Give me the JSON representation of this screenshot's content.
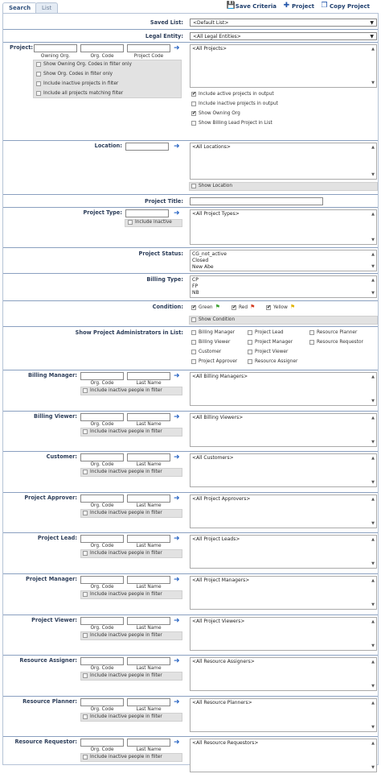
{
  "tabs": [
    {
      "label": "Search"
    },
    {
      "label": "List"
    }
  ],
  "actions": {
    "save": "Save Criteria",
    "project": "Project",
    "copy": "Copy Project"
  },
  "saved_list": {
    "label": "Saved List:",
    "value": "<Default List>"
  },
  "legal_entity": {
    "label": "Legal Entity:",
    "value": "<All Legal Entities>"
  },
  "project": {
    "label": "Project:",
    "sub": [
      "Owning Org.",
      "Org. Code",
      "Project Code"
    ],
    "filters": [
      {
        "label": "Show Owning Org. Codes in filter only",
        "checked": false
      },
      {
        "label": "Show Org. Codes in filter only",
        "checked": false
      },
      {
        "label": "Include inactive projects in filter",
        "checked": false
      },
      {
        "label": "Include all projects matching filter",
        "checked": false
      }
    ],
    "list": "<All Projects>",
    "options": [
      {
        "label": "Include active projects in output",
        "checked": true
      },
      {
        "label": "Include inactive projects in output",
        "checked": false
      },
      {
        "label": "Show Owning Org",
        "checked": true
      },
      {
        "label": "Show Billing Lead Project in List",
        "checked": false
      }
    ]
  },
  "location": {
    "label": "Location:",
    "list": "<All Locations>",
    "show": "Show Location"
  },
  "project_title": {
    "label": "Project Title:"
  },
  "project_type": {
    "label": "Project Type:",
    "include": "Include inactive",
    "list": "<All Project Types>"
  },
  "project_status": {
    "label": "Project Status:",
    "items": [
      "CG_not_active",
      "Closed",
      "New Abe"
    ]
  },
  "billing_type": {
    "label": "Billing Type:",
    "items": [
      "CP",
      "FP",
      "NB"
    ]
  },
  "condition": {
    "label": "Condition:",
    "items": [
      {
        "label": "Green",
        "checked": true,
        "color": "#3aa02e"
      },
      {
        "label": "Red",
        "checked": true,
        "color": "#d33a1f"
      },
      {
        "label": "Yellow",
        "checked": true,
        "color": "#e2b400"
      }
    ],
    "show": "Show Condition"
  },
  "admins": {
    "label": "Show Project Administrators in List:",
    "items": [
      "Billing Manager",
      "Project Lead",
      "Resource Planner",
      "Billing Viewer",
      "Project Manager",
      "Resource Requestor",
      "Customer",
      "Project Viewer",
      "Project Approver",
      "Resource Assigner"
    ]
  },
  "people_sub": {
    "org": "Org. Code",
    "last": "Last Name",
    "inactive": "Include inactive people in filter"
  },
  "people": [
    {
      "label": "Billing Manager:",
      "list": "<All Billing Managers>"
    },
    {
      "label": "Billing Viewer:",
      "list": "<All Billing Viewers>"
    },
    {
      "label": "Customer:",
      "list": "<All Customers>"
    },
    {
      "label": "Project Approver:",
      "list": "<All Project Approvers>"
    },
    {
      "label": "Project Lead:",
      "list": "<All Project Leads>"
    },
    {
      "label": "Project Manager:",
      "list": "<All Project Managers>"
    },
    {
      "label": "Project Viewer:",
      "list": "<All Project Viewers>"
    },
    {
      "label": "Resource Assigner:",
      "list": "<All Resource Assigners>"
    },
    {
      "label": "Resource Planner:",
      "list": "<All Resource Planners>"
    },
    {
      "label": "Resource Requestor:",
      "list": "<All Resource Requestors>"
    }
  ]
}
